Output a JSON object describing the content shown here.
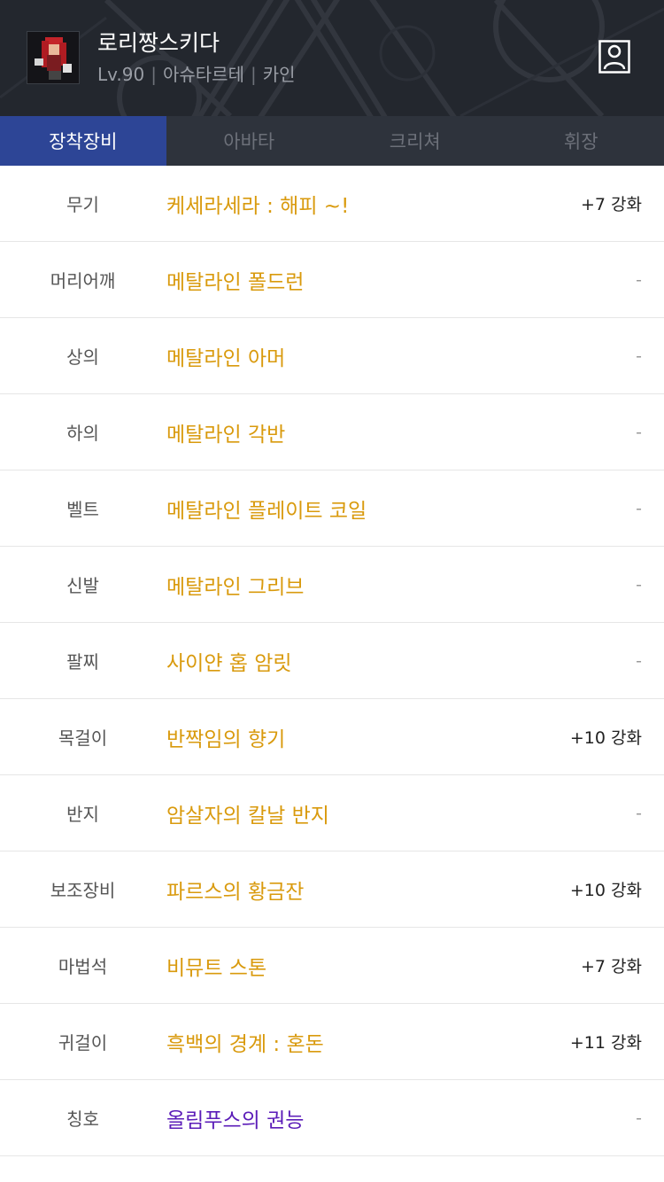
{
  "header": {
    "name": "로리짱스키다",
    "level": "Lv.90",
    "server": "아슈타르테",
    "class": "카인",
    "separator": "|"
  },
  "tabs": [
    {
      "label": "장착장비",
      "active": true
    },
    {
      "label": "아바타",
      "active": false
    },
    {
      "label": "크리쳐",
      "active": false
    },
    {
      "label": "휘장",
      "active": false
    }
  ],
  "colors": {
    "unique": "#d99a0d",
    "legendary": "#5b1cb8",
    "active_tab": "#2d4596"
  },
  "equipment": [
    {
      "slot": "무기",
      "name": "케세라세라 : 해피 ~!",
      "enhance": "+7 강화",
      "rarity": "unique"
    },
    {
      "slot": "머리어깨",
      "name": "메탈라인 폴드런",
      "enhance": "-",
      "rarity": "unique"
    },
    {
      "slot": "상의",
      "name": "메탈라인 아머",
      "enhance": "-",
      "rarity": "unique"
    },
    {
      "slot": "하의",
      "name": "메탈라인 각반",
      "enhance": "-",
      "rarity": "unique"
    },
    {
      "slot": "벨트",
      "name": "메탈라인 플레이트 코일",
      "enhance": "-",
      "rarity": "unique"
    },
    {
      "slot": "신발",
      "name": "메탈라인 그리브",
      "enhance": "-",
      "rarity": "unique"
    },
    {
      "slot": "팔찌",
      "name": "사이얀 홉 암릿",
      "enhance": "-",
      "rarity": "unique"
    },
    {
      "slot": "목걸이",
      "name": "반짝임의 향기",
      "enhance": "+10 강화",
      "rarity": "unique"
    },
    {
      "slot": "반지",
      "name": "암살자의 칼날 반지",
      "enhance": "-",
      "rarity": "unique"
    },
    {
      "slot": "보조장비",
      "name": "파르스의 황금잔",
      "enhance": "+10 강화",
      "rarity": "unique"
    },
    {
      "slot": "마법석",
      "name": "비뮤트 스톤",
      "enhance": "+7 강화",
      "rarity": "unique"
    },
    {
      "slot": "귀걸이",
      "name": "흑백의 경계 : 혼돈",
      "enhance": "+11 강화",
      "rarity": "unique"
    },
    {
      "slot": "칭호",
      "name": "올림푸스의 권능",
      "enhance": "-",
      "rarity": "legendary"
    }
  ]
}
